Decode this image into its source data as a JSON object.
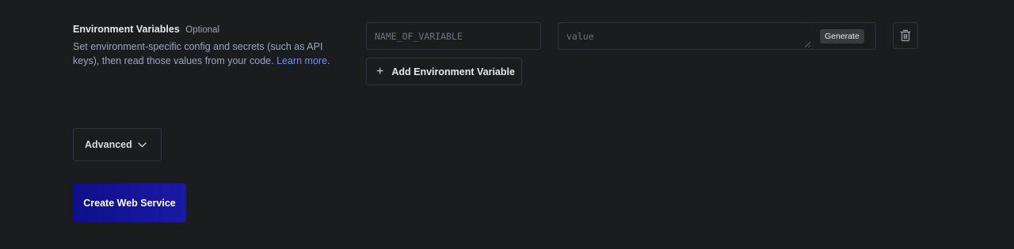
{
  "env_section": {
    "title": "Environment Variables",
    "optional_label": "Optional",
    "description": "Set environment-specific config and secrets (such as API keys), then read those values from your code.",
    "learn_more": "Learn more",
    "description_end": "."
  },
  "env_row": {
    "key_placeholder": "NAME_OF_VARIABLE",
    "value_placeholder": "value",
    "generate_label": "Generate",
    "delete_icon": "trash-icon"
  },
  "add_env_button": {
    "label": "Add Environment Variable",
    "icon": "plus-icon"
  },
  "advanced": {
    "label": "Advanced",
    "icon": "chevron-down-icon"
  },
  "create_button": {
    "label": "Create Web Service"
  },
  "colors": {
    "background": "#1b1c1e",
    "border": "#2b3346",
    "link": "#6c8cff",
    "primary_button": "#1414a0"
  }
}
